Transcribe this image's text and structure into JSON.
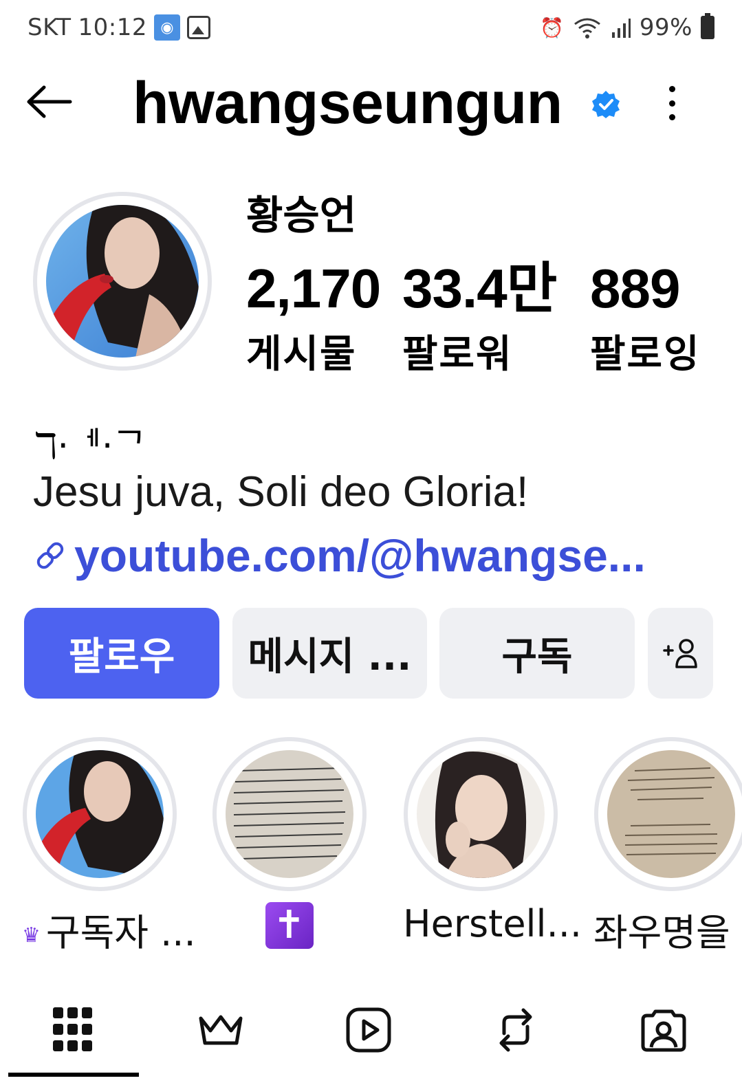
{
  "status_bar": {
    "carrier": "SKT",
    "time": "10:12",
    "battery": "99%"
  },
  "header": {
    "username": "hwangseungun"
  },
  "profile": {
    "display_name": "황승언",
    "stats": [
      {
        "value": "2,170",
        "label": "게시물"
      },
      {
        "value": "33.4만",
        "label": "팔로워"
      },
      {
        "value": "889",
        "label": "팔로잉"
      }
    ]
  },
  "bio": {
    "name_line": "ℸ·ᅦ·ᄀ",
    "text": "Jesu juva, Soli deo Gloria!",
    "link": "youtube.com/@hwangse..."
  },
  "actions": {
    "follow": "팔로우",
    "message": "메시지 ...",
    "subscribe": "구독",
    "add_person": "+ᴑ"
  },
  "highlights": [
    {
      "label": "구독자 ..."
    },
    {
      "label": "✝"
    },
    {
      "label": "Herstell..."
    },
    {
      "label": "좌우명을 ..."
    }
  ],
  "colors": {
    "accent": "#4d62f0",
    "link": "#3c4fd8",
    "button_bg": "#eff0f3",
    "verified": "#1d8cf8"
  },
  "icons": {
    "back": "arrow-left-icon",
    "verified": "verified-badge-icon",
    "more": "more-vertical-icon",
    "link": "link-icon",
    "tabs": [
      "grid-icon",
      "crown-icon",
      "reels-icon",
      "repost-icon",
      "tagged-icon"
    ]
  }
}
